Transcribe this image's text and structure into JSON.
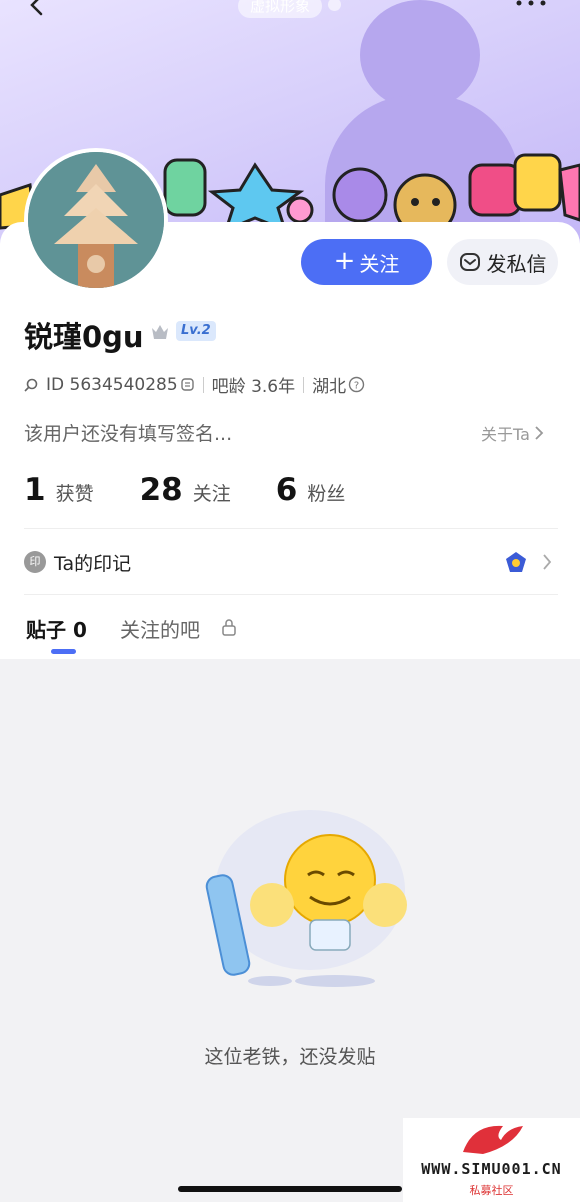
{
  "header": {
    "avatar_label": "虚拟形象"
  },
  "actions": {
    "follow_label": "关注",
    "message_label": "发私信"
  },
  "profile": {
    "username": "锐瑾0gu",
    "level": "Lv.2",
    "id_text": "ID 5634540285",
    "age_text": "吧龄 3.6年",
    "location": "湖北",
    "signature": "该用户还没有填写签名...",
    "about_label": "关于Ta"
  },
  "stats": [
    {
      "value": "1",
      "label": "获赞"
    },
    {
      "value": "28",
      "label": "关注"
    },
    {
      "value": "6",
      "label": "粉丝"
    }
  ],
  "seal": {
    "icon_text": "印",
    "label": "Ta的印记"
  },
  "tabs": {
    "posts_label": "贴子 0",
    "bars_label": "关注的吧"
  },
  "empty_state": {
    "message": "这位老铁，还没发贴"
  },
  "watermark": {
    "site": "WWW.SIMU001.CN",
    "sub": "私募社区"
  },
  "colors": {
    "accent": "#4c6ef5",
    "banner": "#c3b6f7"
  }
}
